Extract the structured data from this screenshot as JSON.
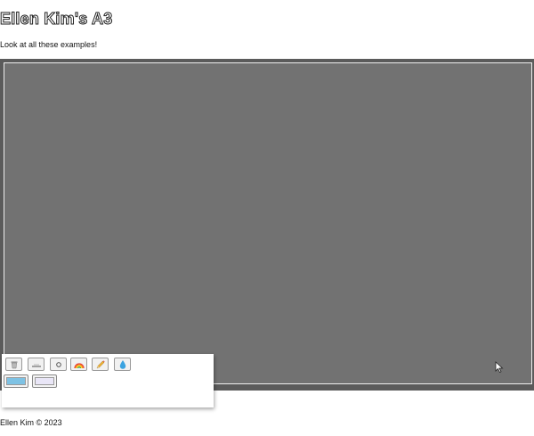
{
  "header": {
    "title": "Ellen Kim's A3",
    "subtitle": "Look at all these examples!"
  },
  "toolbar": {
    "tools": [
      {
        "name": "clear",
        "icon": "trash-icon"
      },
      {
        "name": "erase-line",
        "icon": "line-icon"
      },
      {
        "name": "circle",
        "icon": "circle-icon"
      },
      {
        "name": "rainbow",
        "icon": "rainbow-icon"
      },
      {
        "name": "pencil",
        "icon": "pencil-icon"
      },
      {
        "name": "drop",
        "icon": "water-drop-icon"
      }
    ],
    "swatches": [
      {
        "name": "sky-blue",
        "color": "#7ec2e4"
      },
      {
        "name": "lavender",
        "color": "#e9e6f7"
      }
    ]
  },
  "colors": {
    "canvas": "#727272",
    "frame": "#5b5b5b"
  },
  "footer": {
    "text": "Ellen Kim © 2023"
  }
}
